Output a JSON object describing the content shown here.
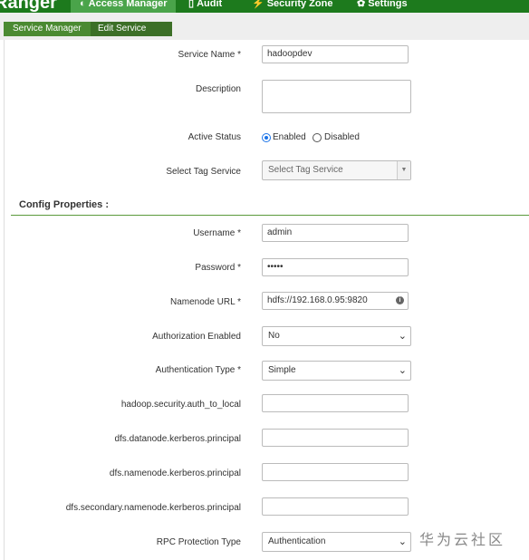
{
  "topnav": {
    "brand": "Ranger",
    "items": [
      {
        "icon": "shield-icon",
        "glyph": "◐",
        "label": "Access Manager"
      },
      {
        "icon": "file-icon",
        "glyph": "▯",
        "label": "Audit"
      },
      {
        "icon": "lightning-icon",
        "glyph": "⚡",
        "label": "Security Zone"
      },
      {
        "icon": "gear-icon",
        "glyph": "✿",
        "label": "Settings"
      }
    ],
    "accent": "#1d7a1d"
  },
  "breadcrumb": [
    "Service Manager",
    "Edit Service"
  ],
  "form": {
    "service_name": {
      "label": "Service Name *",
      "value": "hadoopdev"
    },
    "description": {
      "label": "Description",
      "value": ""
    },
    "active_status": {
      "label": "Active Status",
      "options": [
        "Enabled",
        "Disabled"
      ],
      "selected": "Enabled"
    },
    "tag_service": {
      "label": "Select Tag Service",
      "placeholder": "Select Tag Service"
    }
  },
  "config": {
    "title": "Config Properties :",
    "username": {
      "label": "Username *",
      "value": "admin"
    },
    "password": {
      "label": "Password *",
      "value": "•••••"
    },
    "namenode_url": {
      "label": "Namenode URL *",
      "value": "hdfs://192.168.0.95:9820"
    },
    "authorization_enabled": {
      "label": "Authorization Enabled",
      "value": "No"
    },
    "authentication_type": {
      "label": "Authentication Type *",
      "value": "Simple"
    },
    "auth_to_local": {
      "label": "hadoop.security.auth_to_local",
      "value": ""
    },
    "datanode_principal": {
      "label": "dfs.datanode.kerberos.principal",
      "value": ""
    },
    "namenode_principal": {
      "label": "dfs.namenode.kerberos.principal",
      "value": ""
    },
    "secondary_namenode_principal": {
      "label": "dfs.secondary.namenode.kerberos.principal",
      "value": ""
    },
    "rpc_protection": {
      "label": "RPC Protection Type",
      "value": "Authentication"
    }
  },
  "watermark": "华为云社区"
}
